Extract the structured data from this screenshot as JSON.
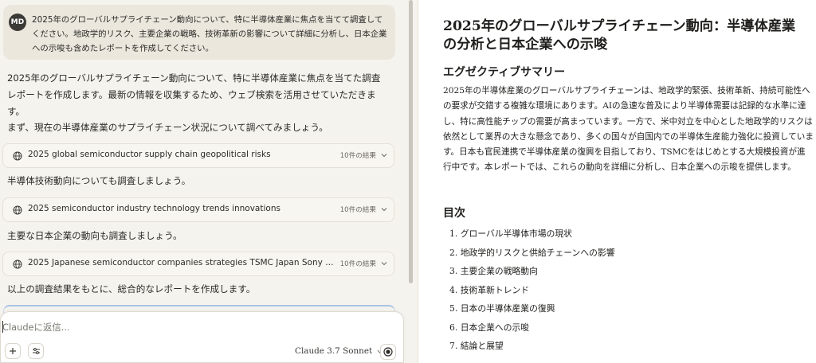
{
  "user_message": {
    "avatar_initials": "MD",
    "text": "2025年のグローバルサプライチェーン動向について、特に半導体産業に焦点を当てて調査してください。地政学的リスク、主要企業の戦略、技術革新の影響について詳細に分析し、日本企業への示唆も含めたレポートを作成してください。"
  },
  "assistant": {
    "p1": "2025年のグローバルサプライチェーン動向について、特に半導体産業に焦点を当てた調査レポートを作成します。最新の情報を収集するため、ウェブ検索を活用させていただきます。",
    "p2": "まず、現在の半導体産業のサプライチェーン状況について調べてみましょう。",
    "p3": "半導体技術動向についても調査しましょう。",
    "p4": "主要な日本企業の動向も調査しましょう。",
    "p5": "以上の調査結果をもとに、総合的なレポートを作成します。"
  },
  "searches": [
    {
      "query": "2025 global semiconductor supply chain geopolitical risks",
      "count": "10件の結果"
    },
    {
      "query": "2025 semiconductor industry technology trends innovations",
      "count": "10件の結果"
    },
    {
      "query": "2025 Japanese semiconductor companies strategies TSMC Japan Sony Rene...",
      "count": "10件の結果"
    }
  ],
  "composer": {
    "placeholder": "Claudeに返信...",
    "model": "Claude 3.7 Sonnet"
  },
  "report": {
    "title": "2025年のグローバルサプライチェーン動向：半導体産業の分析と日本企業への示唆",
    "summary_heading": "エグゼクティブサマリー",
    "summary": "2025年の半導体産業のグローバルサプライチェーンは、地政学的緊張、技術革新、持続可能性への要求が交錯する複雑な環境にあります。AIの急速な普及により半導体需要は記録的な水準に達し、特に高性能チップの需要が高まっています。一方で、米中対立を中心とした地政学的リスクは依然として業界の大きな懸念であり、多くの国々が自国内での半導体生産能力強化に投資しています。日本も官民連携で半導体産業の復興を目指しており、TSMCをはじめとする大規模投資が進行中です。本レポートでは、これらの動向を詳細に分析し、日本企業への示唆を提供します。",
    "toc_heading": "目次",
    "toc": [
      "1. グローバル半導体市場の現状",
      "2. 地政学的リスクと供給チェーンへの影響",
      "3. 主要企業の戦略動向",
      "4. 技術革新トレンド",
      "5. 日本の半導体産業の復興",
      "6. 日本企業への示唆",
      "7. 結論と展望"
    ]
  }
}
